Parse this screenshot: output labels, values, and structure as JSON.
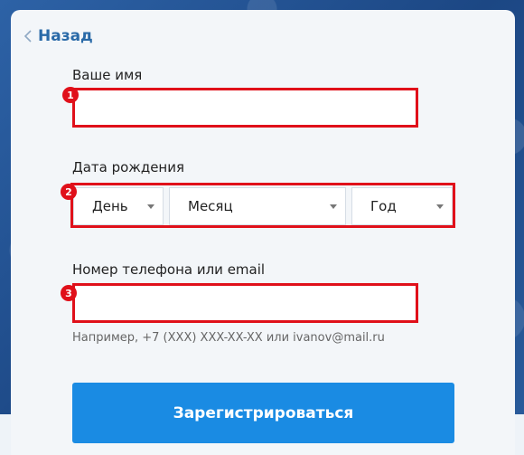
{
  "back": {
    "label": "Назад"
  },
  "name_field": {
    "label": "Ваше имя",
    "value": "",
    "marker": "1"
  },
  "birth_date": {
    "label": "Дата рождения",
    "marker": "2",
    "day": "День",
    "month": "Месяц",
    "year": "Год"
  },
  "contact_field": {
    "label": "Номер телефона или email",
    "value": "",
    "marker": "3",
    "hint": "Например, +7 (XXX) XXX-XX-XX или ivanov@mail.ru"
  },
  "submit": {
    "label": "Зарегистрироваться"
  },
  "colors": {
    "accent": "#1a8be3",
    "link": "#2a6aa8",
    "highlight": "#e0101a",
    "card": "#f3f6f9"
  }
}
